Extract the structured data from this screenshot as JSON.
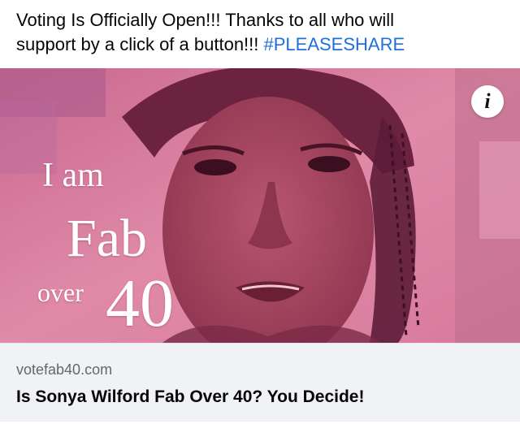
{
  "post": {
    "text_line1": "Voting Is Officially Open!!! Thanks to all who will",
    "text_line2": "support by a click of a button!!!",
    "hashtag": "#PLEASESHARE"
  },
  "media": {
    "overlay_iam": "I am",
    "overlay_fab": "Fab",
    "overlay_over": "over",
    "overlay_40": "40",
    "info_icon": "info-icon",
    "tint_color": "#d9799c"
  },
  "link_card": {
    "domain": "votefab40.com",
    "title": "Is Sonya Wilford Fab Over 40? You Decide!"
  },
  "colors": {
    "hashtag": "#216fdb",
    "card_bg": "#f0f2f5"
  }
}
